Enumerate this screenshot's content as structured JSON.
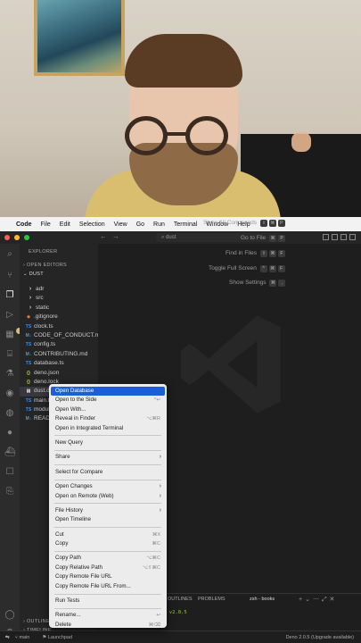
{
  "menubar": {
    "app": "Code",
    "items": [
      "File",
      "Edit",
      "Selection",
      "View",
      "Go",
      "Run",
      "Terminal",
      "Window",
      "Help"
    ]
  },
  "titlebar": {
    "search": "dust"
  },
  "sidebar": {
    "header": "EXPLORER",
    "open_editors": "OPEN EDITORS",
    "project": "DUST",
    "tree": [
      {
        "name": "adr",
        "type": "folder"
      },
      {
        "name": "src",
        "type": "folder"
      },
      {
        "name": "static",
        "type": "folder"
      },
      {
        "name": ".gitignore",
        "type": "file",
        "icon": "◆"
      },
      {
        "name": "clock.ts",
        "type": "file",
        "icon": "TS"
      },
      {
        "name": "CODE_OF_CONDUCT.md",
        "type": "file",
        "icon": "M↓"
      },
      {
        "name": "config.ts",
        "type": "file",
        "icon": "TS"
      },
      {
        "name": "CONTRIBUTING.md",
        "type": "file",
        "icon": "M↓"
      },
      {
        "name": "database.ts",
        "type": "file",
        "icon": "TS"
      },
      {
        "name": "deno.json",
        "type": "file",
        "icon": "{}"
      },
      {
        "name": "deno.lock",
        "type": "file",
        "icon": "{}"
      },
      {
        "name": "dust.db",
        "type": "file",
        "icon": "▤"
      },
      {
        "name": "main.ts",
        "type": "file",
        "icon": "TS"
      },
      {
        "name": "modules.ts",
        "type": "file",
        "icon": "TS"
      },
      {
        "name": "README.md",
        "type": "file",
        "icon": "M↓"
      }
    ],
    "outline": "OUTLINE",
    "timeline": "TIMELINE"
  },
  "editor": {
    "shortcuts": [
      {
        "label": "Show All Commands",
        "keys": [
          "⇧",
          "⌘",
          "P"
        ]
      },
      {
        "label": "Go to File",
        "keys": [
          "⌘",
          "P"
        ]
      },
      {
        "label": "Find in Files",
        "keys": [
          "⇧",
          "⌘",
          "F"
        ]
      },
      {
        "label": "Toggle Full Screen",
        "keys": [
          "^",
          "⌘",
          "F"
        ]
      },
      {
        "label": "Show Settings",
        "keys": [
          "⌘",
          ","
        ]
      }
    ]
  },
  "panel": {
    "tabs": [
      "OUTLINES",
      "PROBLEMS"
    ],
    "terminal_tab": "zsh - books",
    "prompt": "…main [!?] via ⬡ v2.0.5"
  },
  "statusbar": {
    "branch": "main",
    "launchpad": "Launchpad",
    "right": "Deno 2.0.5 (Upgrade available)"
  },
  "context_menu": [
    {
      "label": "Open Database",
      "highlight": true
    },
    {
      "label": "Open to the Side",
      "shortcut": "^↩"
    },
    {
      "label": "Open With..."
    },
    {
      "label": "Reveal in Finder",
      "shortcut": "⌥⌘R"
    },
    {
      "label": "Open in Integrated Terminal"
    },
    {
      "sep": true
    },
    {
      "label": "New Query"
    },
    {
      "sep": true
    },
    {
      "label": "Share",
      "submenu": true
    },
    {
      "sep": true
    },
    {
      "label": "Select for Compare"
    },
    {
      "sep": true
    },
    {
      "label": "Open Changes",
      "submenu": true
    },
    {
      "label": "Open on Remote (Web)",
      "submenu": true
    },
    {
      "sep": true
    },
    {
      "label": "File History",
      "submenu": true
    },
    {
      "label": "Open Timeline"
    },
    {
      "sep": true
    },
    {
      "label": "Cut",
      "shortcut": "⌘X"
    },
    {
      "label": "Copy",
      "shortcut": "⌘C"
    },
    {
      "sep": true
    },
    {
      "label": "Copy Path",
      "shortcut": "⌥⌘C"
    },
    {
      "label": "Copy Relative Path",
      "shortcut": "⌥⇧⌘C"
    },
    {
      "label": "Copy Remote File URL"
    },
    {
      "label": "Copy Remote File URL From..."
    },
    {
      "sep": true
    },
    {
      "label": "Run Tests"
    },
    {
      "sep": true
    },
    {
      "label": "Rename...",
      "shortcut": "↩"
    },
    {
      "label": "Delete",
      "shortcut": "⌘⌫"
    }
  ]
}
